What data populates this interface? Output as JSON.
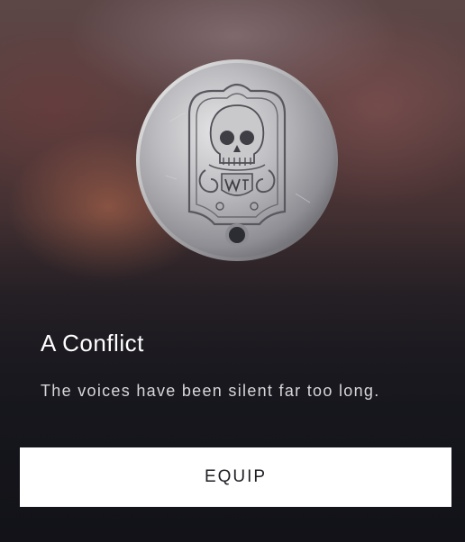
{
  "item": {
    "image_icon": "silver-skull-dog-tag-icon",
    "title": "A Conflict",
    "description": "The voices have been silent far too long."
  },
  "actions": {
    "equip_label": "EQUIP"
  },
  "colors": {
    "button_background": "#ffffff",
    "button_text": "#1e1e24",
    "title_text": "#ffffff",
    "description_text": "#d8d6d8",
    "background_top": "#5c4646",
    "background_bottom": "#1b1c22"
  }
}
